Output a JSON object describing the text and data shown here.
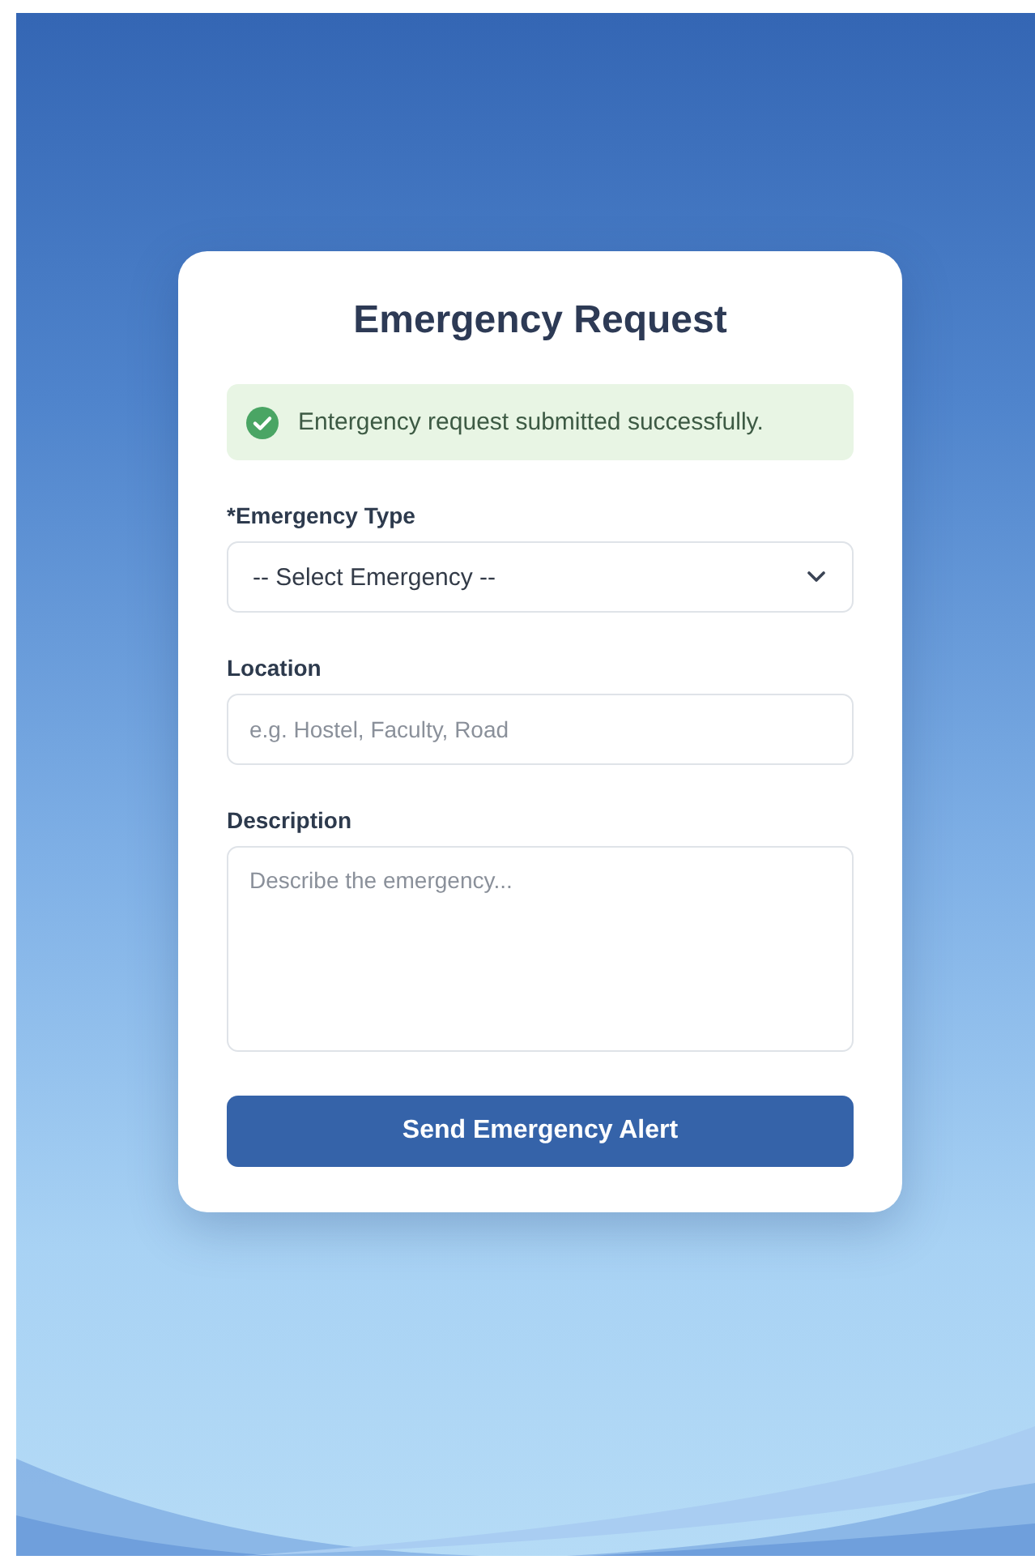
{
  "title": "Emergency Request",
  "alert": {
    "kind": "success",
    "text": "Entergency request submitted successfully."
  },
  "fields": [
    {
      "kind": "select",
      "label": "*Emergency Type",
      "value": "-- Select Emergency --"
    },
    {
      "kind": "input",
      "label": "Location",
      "placeholder": "e.g. Hostel, Faculty, Road"
    },
    {
      "kind": "textarea",
      "label": "Description",
      "placeholder": "Describe the emergency..."
    }
  ],
  "button": "Send Emergency Alert"
}
